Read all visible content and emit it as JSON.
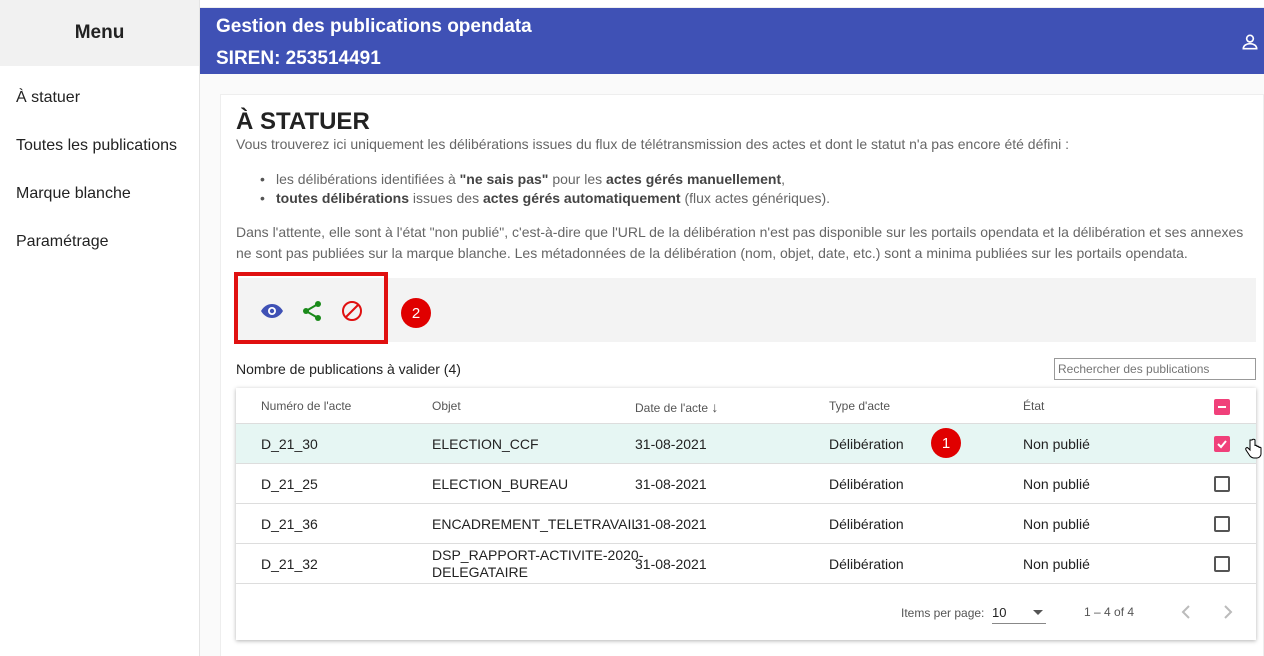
{
  "sidebar": {
    "title": "Menu",
    "items": [
      {
        "label": "À statuer"
      },
      {
        "label": "Toutes les publications"
      },
      {
        "label": "Marque blanche"
      },
      {
        "label": "Paramétrage"
      }
    ]
  },
  "header": {
    "title": "Gestion des publications opendata",
    "siren": "SIREN: 253514491"
  },
  "page": {
    "title": "À STATUER",
    "intro": "Vous trouverez ici uniquement les délibérations issues du flux de télétransmission des actes et dont le statut n'a pas encore été défini :",
    "bullet1": {
      "a": "les délibérations identifiées à ",
      "b": "\"ne sais pas\"",
      "c": " pour les ",
      "d": "actes gérés manuellement",
      "e": ","
    },
    "bullet2": {
      "a": "toutes délibérations",
      "b": " issues des ",
      "c": "actes gérés automatiquement",
      "d": " (flux actes génériques)."
    },
    "para": "Dans l'attente, elle sont à l'état \"non publié\", c'est-à-dire que l'URL de la délibération n'est pas disponible sur les portails opendata et la délibération et ses annexes ne sont pas publiées sur la marque blanche. Les métadonnées de la délibération (nom, objet, date, etc.) sont a minima publiées sur les portails opendata."
  },
  "toolbar": {
    "icons": [
      "eye-icon",
      "share-icon",
      "block-icon"
    ],
    "colors": {
      "eye": "#3f51b5",
      "share": "#1a8a1a",
      "block": "#e01010"
    },
    "badge2": "2"
  },
  "list": {
    "count_label": "Nombre de publications à valider (4)",
    "search_placeholder": "Rechercher des publications",
    "columns": [
      "Numéro de l'acte",
      "Objet",
      "Date de l'acte",
      "Type d'acte",
      "État"
    ],
    "sort_arrow": "↓",
    "badge1": "1",
    "rows": [
      {
        "numero": "D_21_30",
        "objet": "ELECTION_CCF",
        "date": "31-08-2021",
        "type": "Délibération",
        "etat": "Non publié",
        "checked": true
      },
      {
        "numero": "D_21_25",
        "objet": "ELECTION_BUREAU",
        "date": "31-08-2021",
        "type": "Délibération",
        "etat": "Non publié",
        "checked": false
      },
      {
        "numero": "D_21_36",
        "objet": "ENCADREMENT_TELETRAVAIL",
        "date": "31-08-2021",
        "type": "Délibération",
        "etat": "Non publié",
        "checked": false
      },
      {
        "numero": "D_21_32",
        "objet": "DSP_RAPPORT-ACTIVITE-2020-DELEGATAIRE",
        "objet_l1": "DSP_RAPPORT-ACTIVITE-2020-",
        "objet_l2": "DELEGATAIRE",
        "date": "31-08-2021",
        "type": "Délibération",
        "etat": "Non publié",
        "checked": false
      }
    ],
    "paginator": {
      "items_per_page_label": "Items per page:",
      "items_per_page": "10",
      "range": "1 – 4 of 4"
    }
  }
}
